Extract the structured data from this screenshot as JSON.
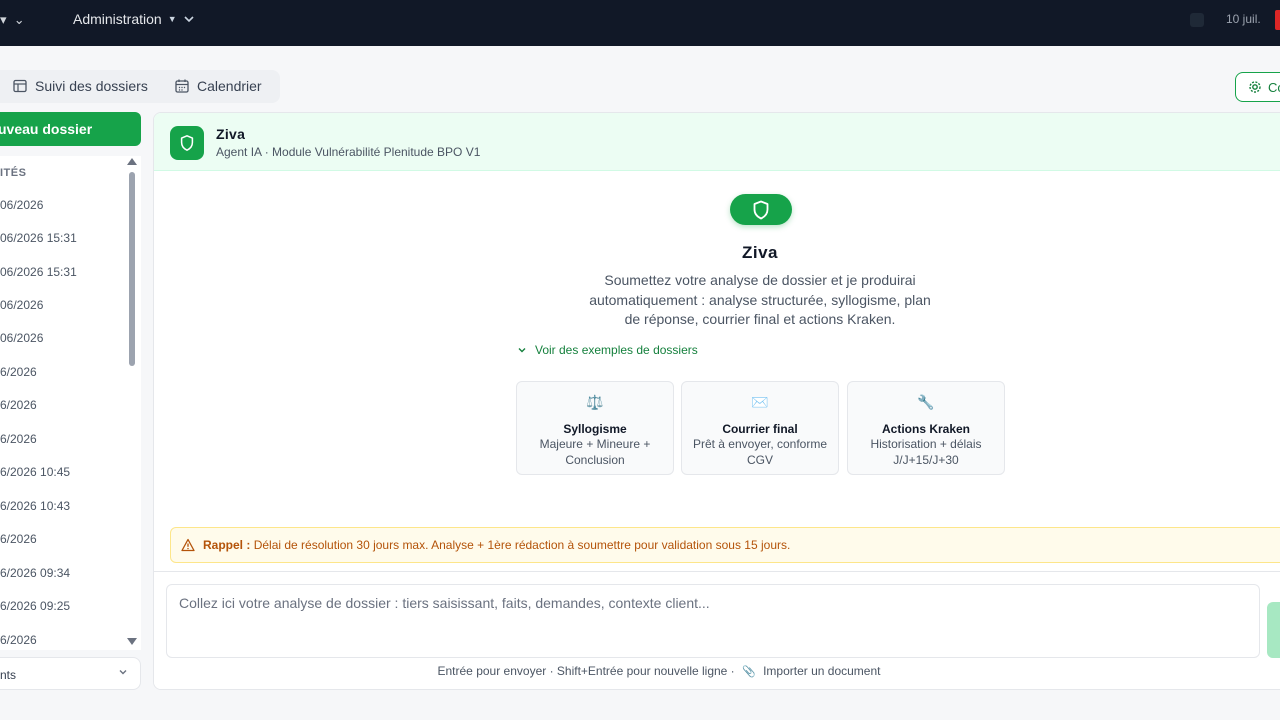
{
  "topbar": {
    "admin_label": "Administration",
    "date": "10 juil."
  },
  "tabs": [
    {
      "label": "Suivi des dossiers",
      "icon": "table-icon"
    },
    {
      "label": "Calendrier",
      "icon": "calendar-icon"
    }
  ],
  "config_button": {
    "label": "Co"
  },
  "sidebar": {
    "new_button_label": "uveau dossier",
    "section_label": "ITÉS",
    "items": [
      "06/2026",
      "06/2026 15:31",
      "06/2026 15:31",
      "06/2026",
      "06/2026",
      "6/2026",
      "6/2026",
      "6/2026",
      "6/2026 10:45",
      "6/2026 10:43",
      "6/2026",
      "6/2026 09:34",
      "6/2026 09:25",
      "6/2026"
    ],
    "footer_label": "nts"
  },
  "agent": {
    "name": "Ziva",
    "subtitle": "Agent IA · Module Vulnérabilité Plenitude BPO V1"
  },
  "hero": {
    "title": "Ziva",
    "description": "Soumettez votre analyse de dossier et je produirai automatiquement : analyse structurée, syllogisme, plan de réponse, courrier final et actions Kraken.",
    "examples_link": "Voir des exemples de dossiers"
  },
  "cards": [
    {
      "icon": "⚖️",
      "title": "Syllogisme",
      "description": "Majeure + Mineure + Conclusion"
    },
    {
      "icon": "✉️",
      "title": "Courrier final",
      "description": "Prêt à envoyer, conforme CGV"
    },
    {
      "icon": "🔧",
      "title": "Actions Kraken",
      "description": "Historisation + délais J/J+15/J+30"
    }
  ],
  "reminder": {
    "label": "Rappel :",
    "text": "Délai de résolution 30 jours max. Analyse + 1ère rédaction à soumettre pour validation sous 15 jours."
  },
  "composer": {
    "placeholder": "Collez ici votre analyse de dossier : tiers saisissant, faits, demandes, contexte client...",
    "hint_before": "Entrée pour envoyer · Shift+Entrée pour nouvelle ligne ·",
    "hint_import": "Importer un document"
  },
  "colors": {
    "brand": "#16a34a",
    "topbar": "#111827",
    "warning": "#b45309"
  }
}
